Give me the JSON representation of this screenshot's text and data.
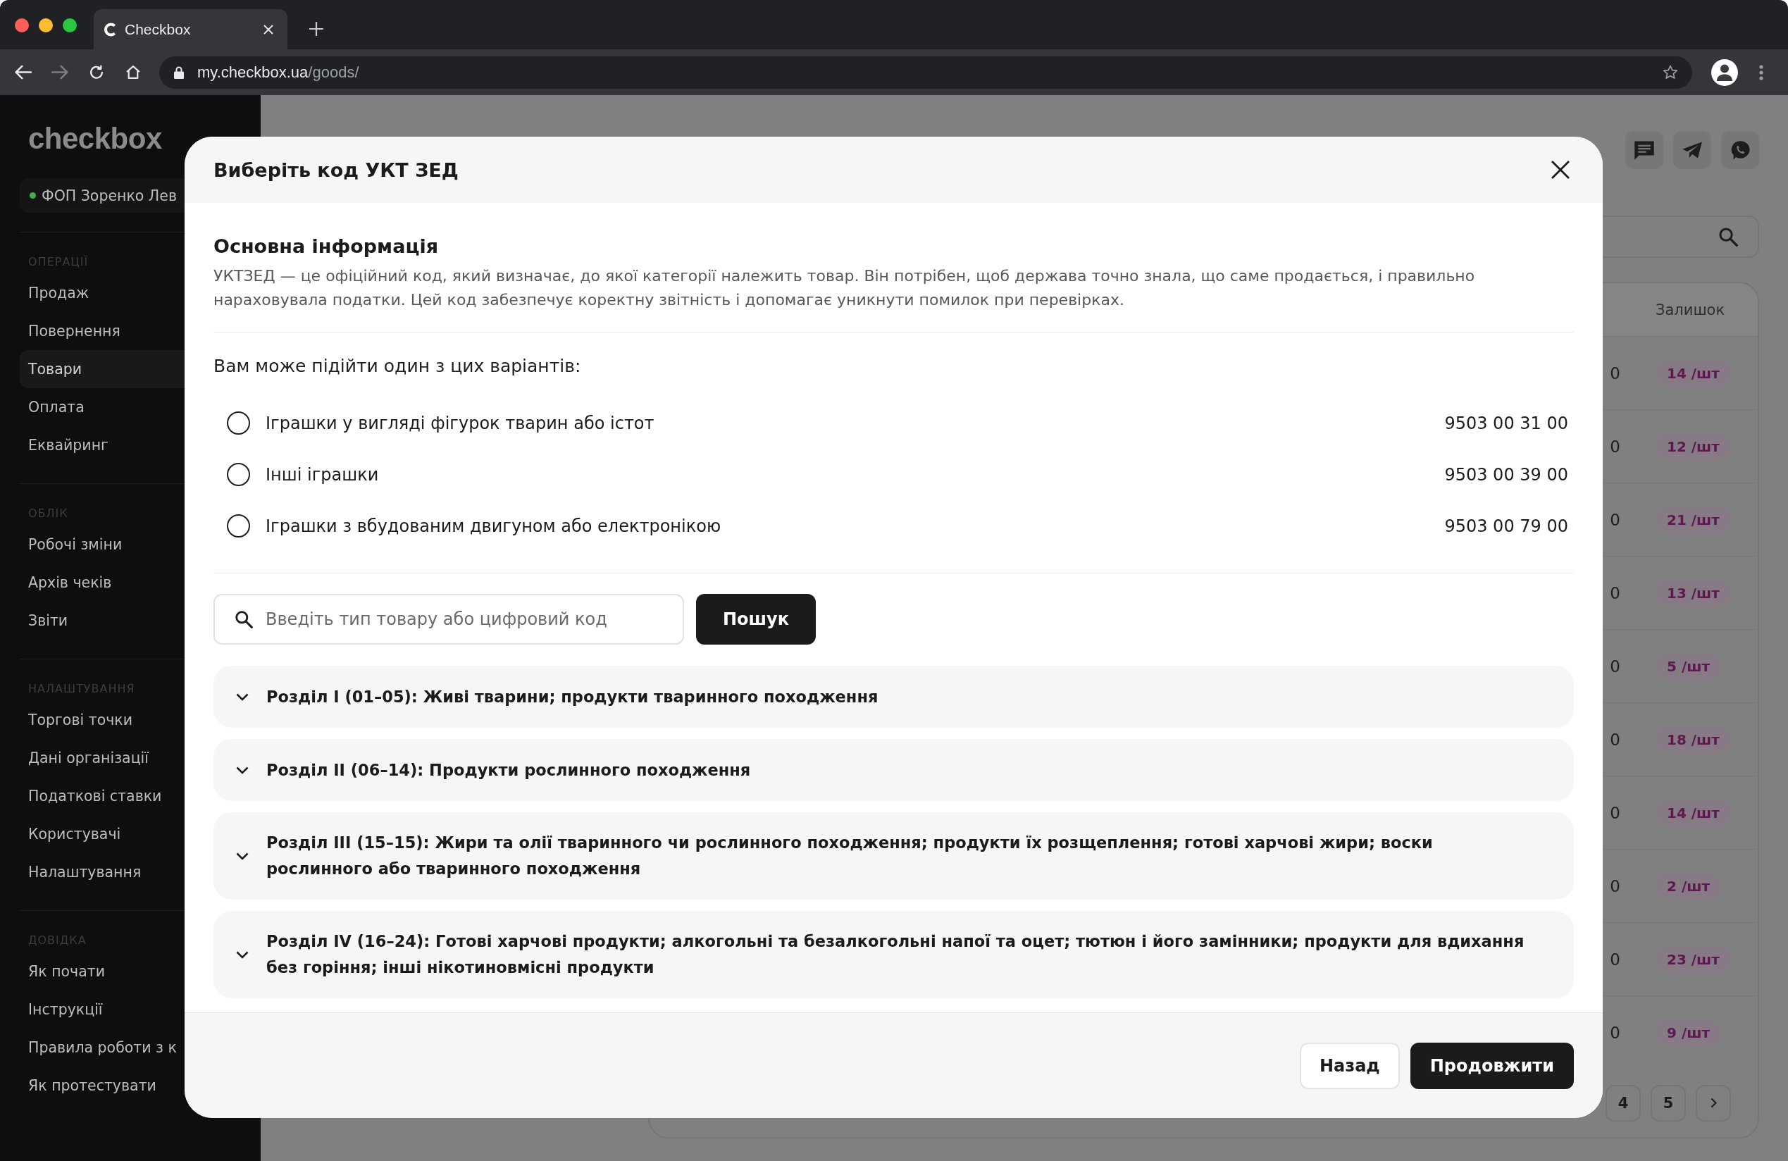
{
  "browser": {
    "tab_title": "Checkbox",
    "url_host": "my.checkbox.ua",
    "url_path": "/goods/"
  },
  "sidebar": {
    "logo": "checkbox",
    "account": "ФОП Зоренко Лев",
    "sections": [
      {
        "title": "ОПЕРАЦІЇ",
        "items": [
          {
            "label": "Продаж",
            "selected": false
          },
          {
            "label": "Повернення",
            "selected": false
          },
          {
            "label": "Товари",
            "selected": true
          },
          {
            "label": "Оплата",
            "selected": false
          },
          {
            "label": "Еквайринг",
            "selected": false
          }
        ]
      },
      {
        "title": "ОБЛІК",
        "items": [
          {
            "label": "Робочі зміни",
            "selected": false
          },
          {
            "label": "Архів чеків",
            "selected": false
          },
          {
            "label": "Звіти",
            "selected": false
          }
        ]
      },
      {
        "title": "НАЛАШТУВАННЯ",
        "items": [
          {
            "label": "Торгові точки",
            "selected": false
          },
          {
            "label": "Дані організації",
            "selected": false
          },
          {
            "label": "Податкові ставки",
            "selected": false
          },
          {
            "label": "Користувачі",
            "selected": false
          },
          {
            "label": "Налаштування",
            "selected": false
          }
        ]
      },
      {
        "title": "ДОВІДКА",
        "items": [
          {
            "label": "Як почати",
            "selected": false
          },
          {
            "label": "Інструкції",
            "selected": false
          },
          {
            "label": "Правила роботи з к",
            "selected": false
          },
          {
            "label": "Як протестувати",
            "selected": false
          }
        ]
      }
    ]
  },
  "table": {
    "stock_header": "Залишок",
    "rows": [
      {
        "column_1": "0",
        "stock": "14 /шт"
      },
      {
        "column_1": "0",
        "stock": "12 /шт"
      },
      {
        "column_1": "0",
        "stock": "21 /шт"
      },
      {
        "column_1": "0",
        "stock": "13 /шт"
      },
      {
        "column_1": "0",
        "stock": "5 /шт"
      },
      {
        "column_1": "0",
        "stock": "18 /шт"
      },
      {
        "column_1": "0",
        "stock": "14 /шт"
      },
      {
        "column_1": "0",
        "stock": "2 /шт"
      },
      {
        "column_1": "0",
        "stock": "23 /шт"
      },
      {
        "column_1": "0",
        "stock": "9 /шт"
      }
    ]
  },
  "pagination": {
    "pages": [
      {
        "label": "4",
        "selected": false
      },
      {
        "label": "5",
        "selected": false
      }
    ]
  },
  "modal": {
    "title": "Виберіть код УКТ ЗЕД",
    "info_title": "Основна інформація",
    "info_text": "УКТЗЕД — це офіційний код, який визначає, до якої категорії належить товар. Він потрібен, щоб держава точно знала, що саме продається, і правильно нараховувала податки. Цей код забезпечує коректну звітність і допомагає уникнути помилок при перевірках.",
    "suggestions_title": "Вам може підійти один з цих варіантів:",
    "options": [
      {
        "label": "Іграшки у вигляді фігурок тварин або істот",
        "code": "9503 00 31 00",
        "selected": false
      },
      {
        "label": "Інші іграшки",
        "code": "9503 00 39 00",
        "selected": false
      },
      {
        "label": "Іграшки з вбудованим двигуном або електронікою",
        "code": "9503 00 79 00",
        "selected": false
      }
    ],
    "search": {
      "placeholder": "Введіть тип товару або цифровий код",
      "button": "Пошук"
    },
    "sections": [
      {
        "label": "Розділ I (01–05): Живі тварини; продукти тваринного походження",
        "expanded": false
      },
      {
        "label": "Розділ II (06–14): Продукти рослинного походження",
        "expanded": false
      },
      {
        "label": "Розділ III (15–15): Жири та олії тваринного чи рослинного походження; продукти їх розщеплення; готові харчові жири; воски рослинного або тваринного походження",
        "expanded": false
      },
      {
        "label": "Розділ IV (16–24): Готові харчові продукти; алкогольні та безалкогольні напої та оцет; тютюн і його замінники; продукти для вдихання без горіння; інші нікотиновмісні продукти",
        "expanded": false
      }
    ],
    "buttons": [
      {
        "label": "Назад",
        "kind": "secondary"
      },
      {
        "label": "Продовжити",
        "kind": "primary"
      }
    ]
  }
}
